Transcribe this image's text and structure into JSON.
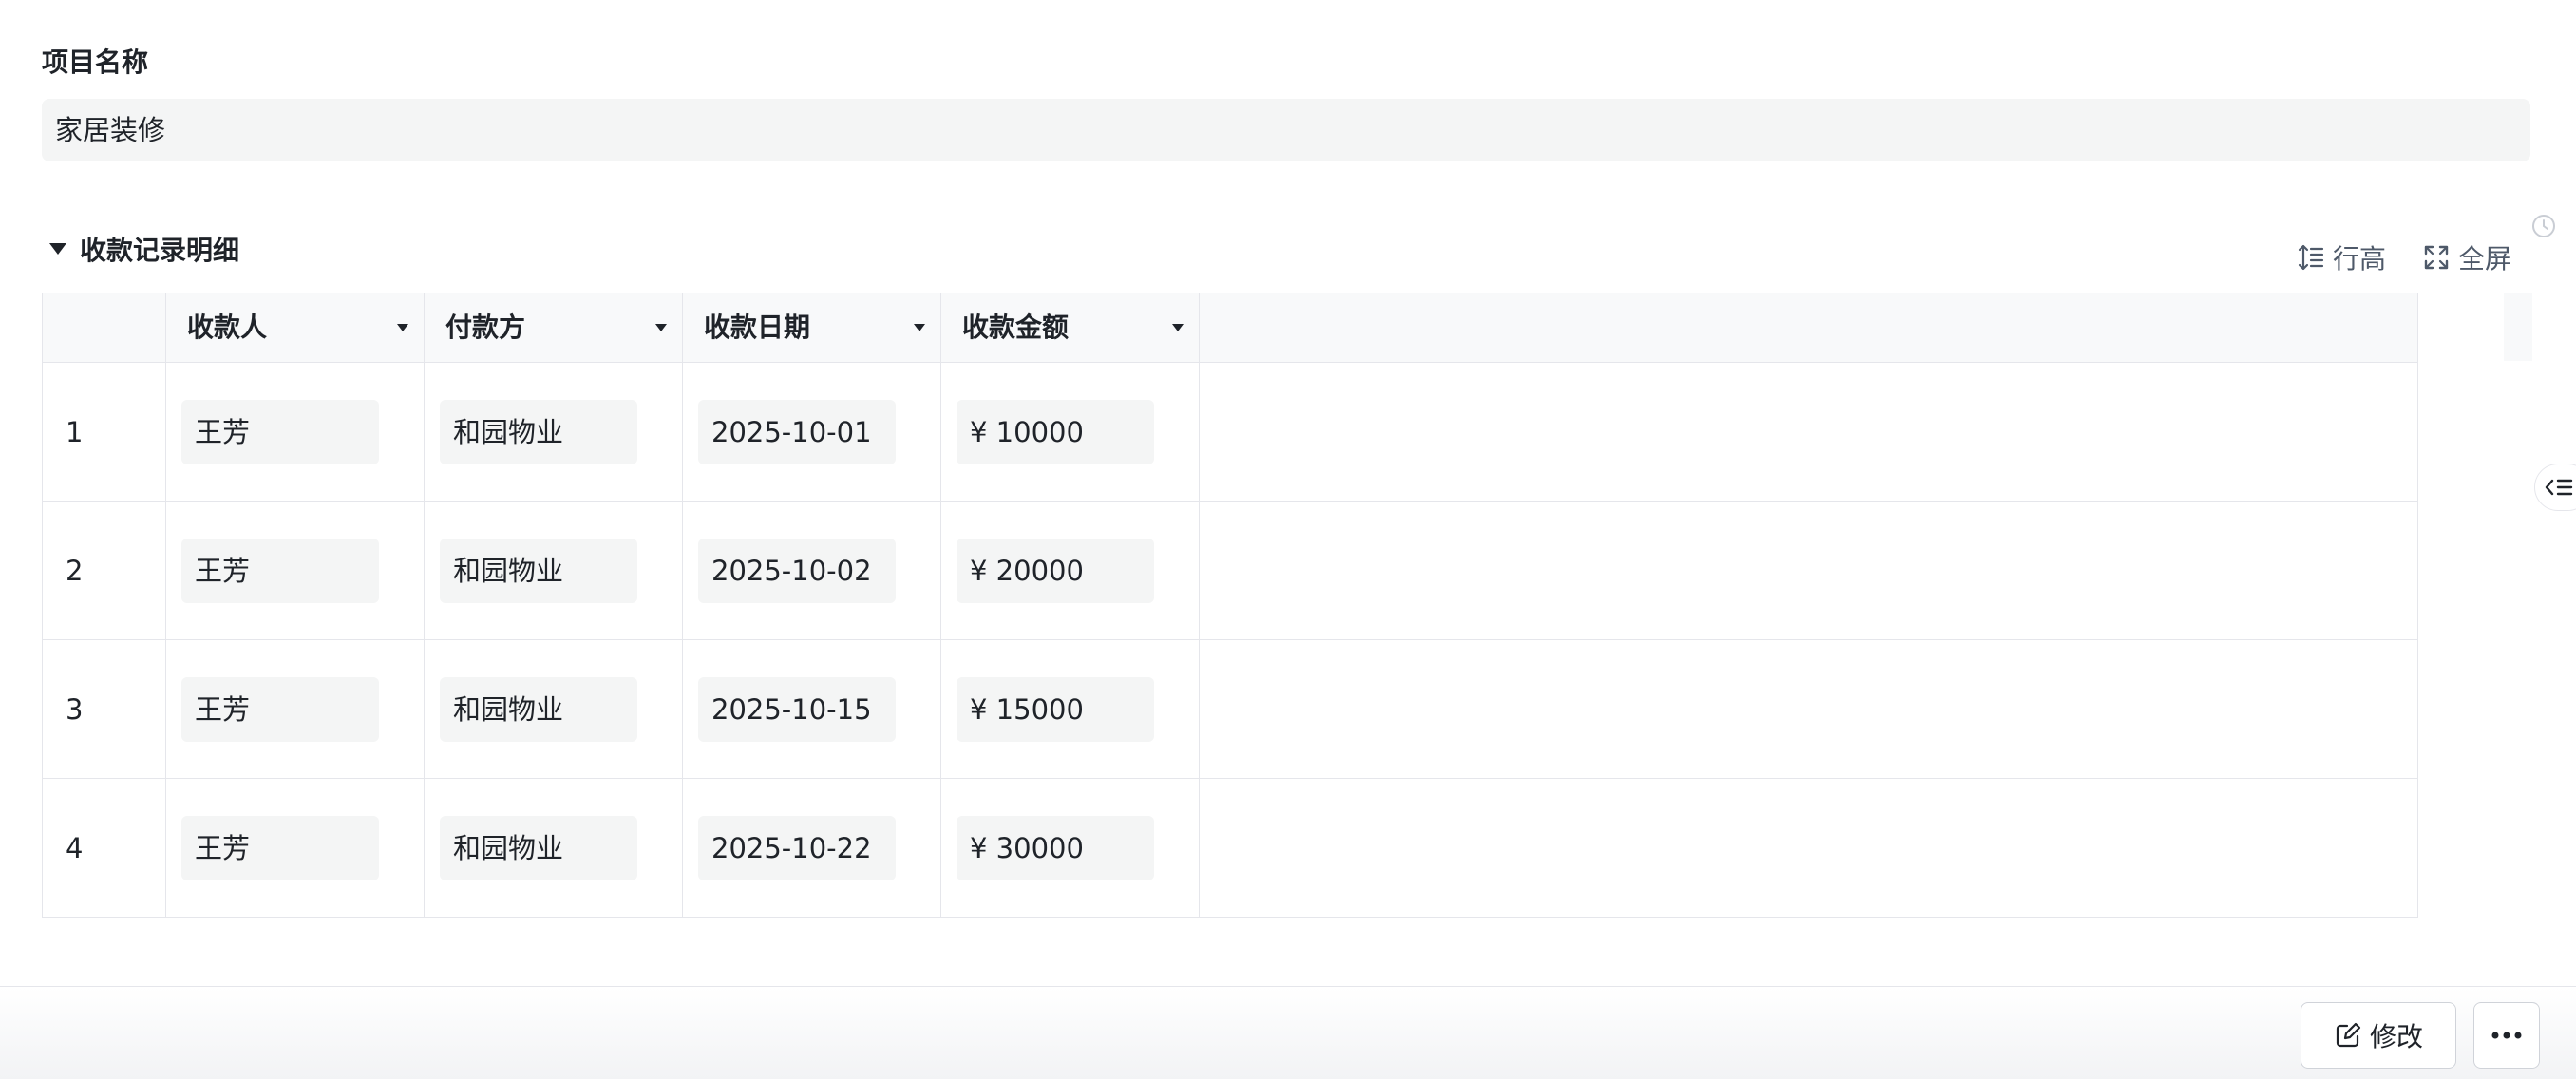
{
  "project": {
    "label": "项目名称",
    "value": "家居装修"
  },
  "section": {
    "title": "收款记录明细"
  },
  "toolbar": {
    "row_height_label": "行高",
    "fullscreen_label": "全屏"
  },
  "table": {
    "columns": [
      "收款人",
      "付款方",
      "收款日期",
      "收款金额"
    ],
    "rows": [
      {
        "index": "1",
        "payee": "王芳",
        "payer": "和园物业",
        "date": "2025-10-01",
        "amount": "¥ 10000"
      },
      {
        "index": "2",
        "payee": "王芳",
        "payer": "和园物业",
        "date": "2025-10-02",
        "amount": "¥ 20000"
      },
      {
        "index": "3",
        "payee": "王芳",
        "payer": "和园物业",
        "date": "2025-10-15",
        "amount": "¥ 15000"
      },
      {
        "index": "4",
        "payee": "王芳",
        "payer": "和园物业",
        "date": "2025-10-22",
        "amount": "¥ 30000"
      }
    ]
  },
  "footer": {
    "edit_label": "修改"
  },
  "icons": {
    "history": "history-icon",
    "row_height": "row-height-icon",
    "fullscreen": "fullscreen-icon",
    "edit": "edit-icon",
    "more": "more-icon",
    "side_panel": "side-panel-toggle-icon"
  }
}
